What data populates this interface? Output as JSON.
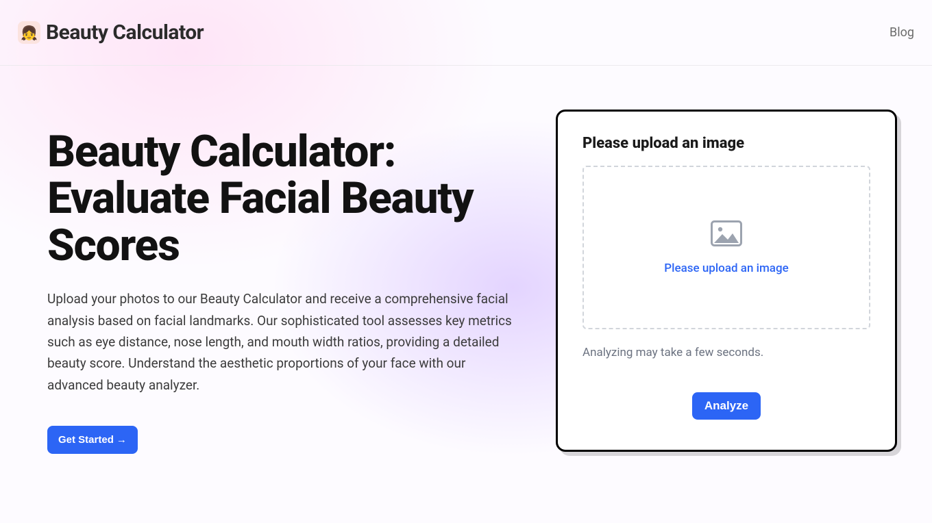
{
  "header": {
    "brand": "Beauty Calculator",
    "logo_emoji": "👧",
    "blog_link": "Blog"
  },
  "hero": {
    "title": "Beauty Calculator: Evaluate Facial Beauty Scores",
    "description": "Upload your photos to our Beauty Calculator and receive a comprehensive facial analysis based on facial landmarks. Our sophisticated tool assesses key metrics such as eye distance, nose length, and mouth width ratios, providing a detailed beauty score. Understand the aesthetic proportions of your face with our advanced beauty analyzer.",
    "cta_label": "Get Started",
    "cta_arrow": "→"
  },
  "uploader": {
    "title": "Please upload an image",
    "drop_text": "Please upload an image",
    "note": "Analyzing may take a few seconds.",
    "analyze_label": "Analyze"
  },
  "colors": {
    "primary": "#2c65f5"
  }
}
